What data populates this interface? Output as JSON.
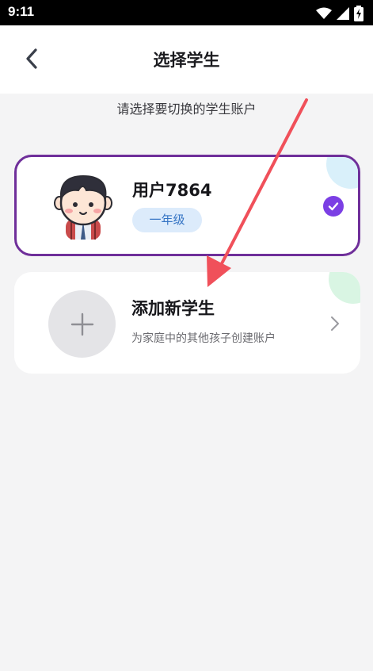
{
  "status_bar": {
    "time": "9:11",
    "icons": [
      "wifi-icon",
      "signal-icon",
      "battery-charging-icon"
    ]
  },
  "header": {
    "title": "选择学生",
    "back_icon": "chevron-left-icon"
  },
  "subtitle": "请选择要切换的学生账户",
  "current_student": {
    "name": "用户7864",
    "grade": "一年级",
    "selected": true,
    "accent_color": "#6f2f9a",
    "check_color": "#7b3fe4"
  },
  "add_student": {
    "title": "添加新学生",
    "description": "为家庭中的其他孩子创建账户"
  },
  "annotation": {
    "color": "#f0505a"
  }
}
